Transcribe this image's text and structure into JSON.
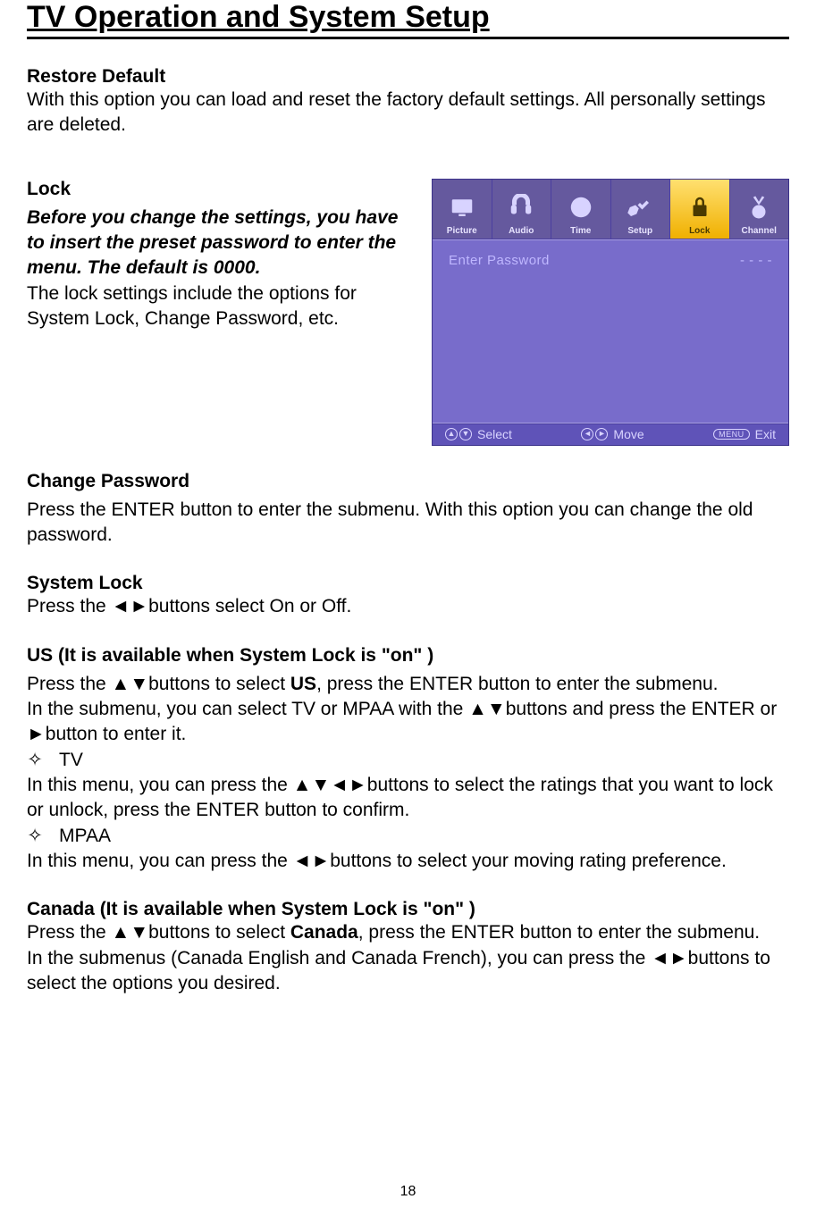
{
  "title": "TV Operation and System Setup",
  "sections": {
    "restore": {
      "heading": "Restore Default",
      "body": "With this option you can load and reset the factory default settings. All personally settings are deleted."
    },
    "lock": {
      "heading": "Lock",
      "note": "Before you change the settings, you have to insert the preset password to enter the menu. The default is 0000.",
      "body": "The lock settings include the options for System Lock, Change Password, etc."
    },
    "change_password": {
      "heading": "Change Password",
      "body": "Press the ENTER button to enter the submenu. With this option you can change the old password."
    },
    "system_lock": {
      "heading": "System Lock",
      "body": "Press the ◄►buttons select On or Off."
    },
    "us": {
      "heading": "US (It is available when System Lock is \"on\" )",
      "p1_a": "Press the ▲▼buttons to select ",
      "p1_b": "US",
      "p1_c": ", press the ENTER button to enter the submenu.",
      "p2": "In the submenu, you can select TV or MPAA with the ▲▼buttons and press the ENTER or ►button to enter it.",
      "bullets": {
        "tv_label": "TV",
        "tv_body": "In this menu, you can press the ▲▼◄►buttons to select the ratings that you want to lock or unlock, press the ENTER button to confirm.",
        "mpaa_label": "MPAA",
        "mpaa_body": "In this menu, you can press the ◄►buttons to select your moving rating preference."
      }
    },
    "canada": {
      "heading": "Canada (It is available when System Lock is \"on\" )",
      "p1_a": "Press the ▲▼buttons to select ",
      "p1_b": "Canada",
      "p1_c": ", press the ENTER button to enter the submenu.",
      "p2": "In the submenus (Canada English and Canada French), you can press the ◄►buttons to select the options you desired."
    }
  },
  "osd": {
    "tabs": [
      "Picture",
      "Audio",
      "Time",
      "Setup",
      "Lock",
      "Channel"
    ],
    "active_tab_index": 4,
    "enter_password_label": "Enter Password",
    "enter_password_value": "- - - -",
    "hints": {
      "select": "Select",
      "move": "Move",
      "menu_key": "MENU",
      "exit": "Exit"
    }
  },
  "bullet_symbol": "✧",
  "page_number": "18"
}
